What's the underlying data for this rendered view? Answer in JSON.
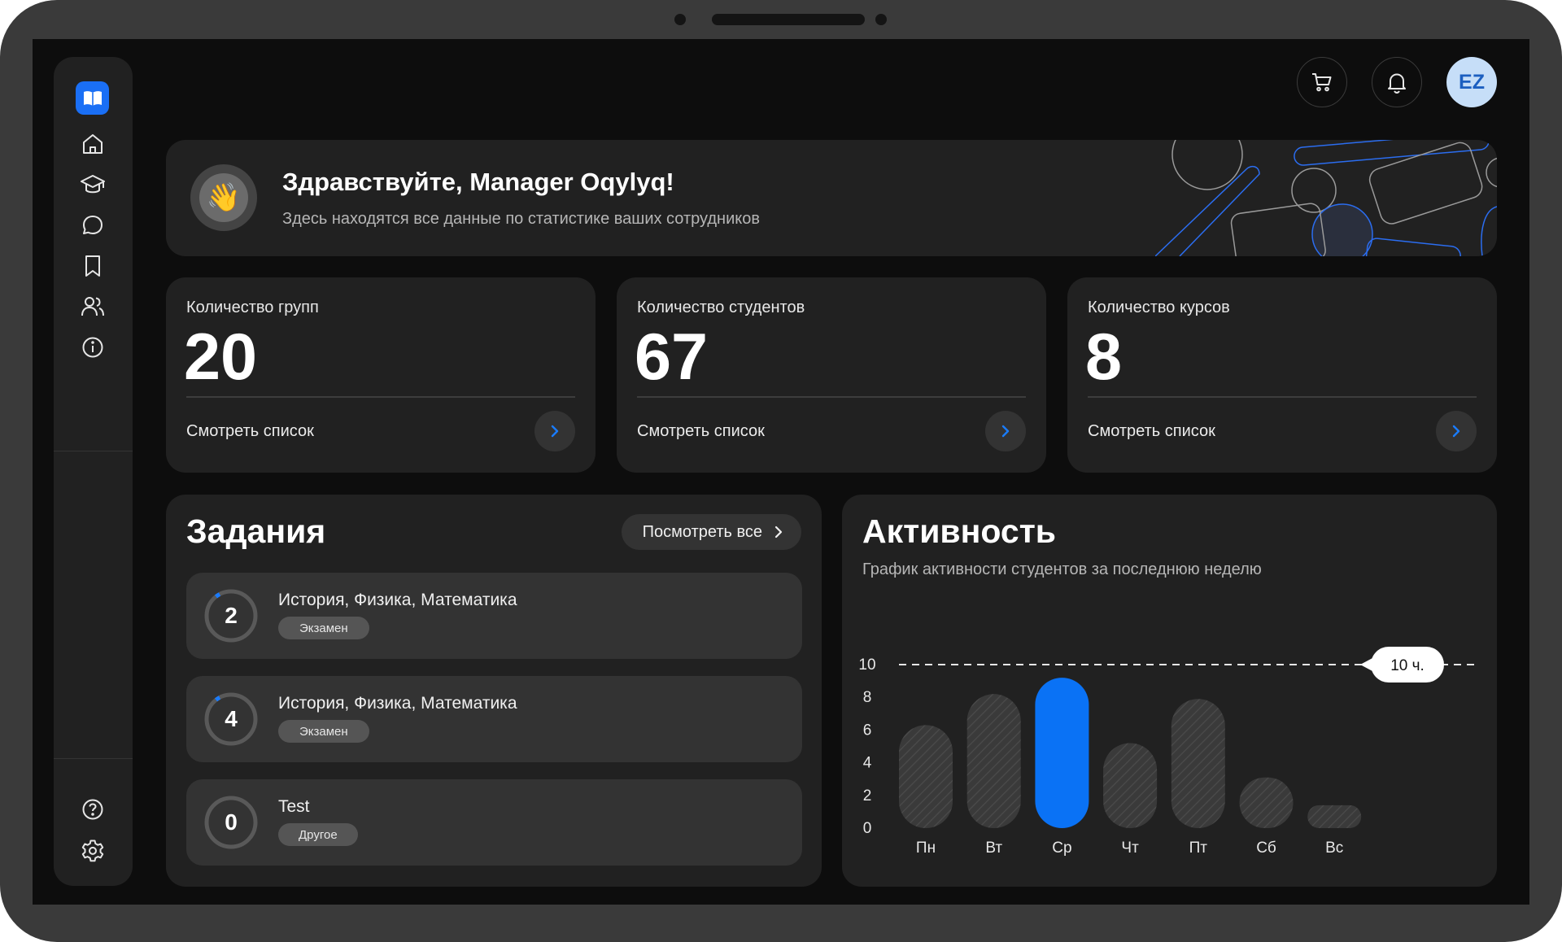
{
  "topbar": {
    "avatar_initials": "EZ",
    "cart_icon": "cart-icon",
    "bell_icon": "bell-icon"
  },
  "sidebar": {
    "items": [
      {
        "name": "home",
        "icon": "home-icon"
      },
      {
        "name": "courses",
        "icon": "graduation-cap-icon"
      },
      {
        "name": "messages",
        "icon": "chat-bubble-icon"
      },
      {
        "name": "bookmarks",
        "icon": "bookmark-icon"
      },
      {
        "name": "users",
        "icon": "users-icon"
      },
      {
        "name": "info",
        "icon": "info-icon"
      }
    ],
    "bottom_items": [
      {
        "name": "help",
        "icon": "help-icon"
      },
      {
        "name": "settings",
        "icon": "gear-icon"
      }
    ]
  },
  "welcome": {
    "title": "Здравствуйте, Manager Oqylyq!",
    "subtitle": "Здесь находятся все данные по статистике ваших сотрудников"
  },
  "stats": [
    {
      "label": "Количество групп",
      "value": "20",
      "link": "Смотреть список"
    },
    {
      "label": "Количество студентов",
      "value": "67",
      "link": "Смотреть список"
    },
    {
      "label": "Количество курсов",
      "value": "8",
      "link": "Смотреть список"
    }
  ],
  "tasks": {
    "title": "Задания",
    "view_all": "Посмотреть все",
    "items": [
      {
        "count": "2",
        "title": "История, Физика, Математика",
        "badge": "Экзамен",
        "has_progress": true
      },
      {
        "count": "4",
        "title": "История, Физика, Математика",
        "badge": "Экзамен",
        "has_progress": true
      },
      {
        "count": "0",
        "title": "Test",
        "badge": "Другое",
        "has_progress": false
      }
    ]
  },
  "activity": {
    "title": "Активность",
    "subtitle": "График активности студентов за последнюю неделю"
  },
  "chart_data": {
    "type": "bar",
    "categories": [
      "Пн",
      "Вт",
      "Ср",
      "Чт",
      "Пт",
      "Сб",
      "Вс"
    ],
    "values": [
      6.3,
      8.2,
      9.2,
      5.2,
      7.9,
      3.1,
      1.4
    ],
    "highlight_index": 2,
    "reference_line": {
      "value": 10,
      "label": "10 ч."
    },
    "yticks": [
      0,
      2,
      4,
      6,
      8,
      10
    ],
    "ylim": [
      0,
      10
    ],
    "title": "",
    "xlabel": "",
    "ylabel": "",
    "colors": {
      "highlight": "#0a72f5",
      "bar": "#3a3a3a",
      "hatch": "#4a4a4a"
    }
  }
}
